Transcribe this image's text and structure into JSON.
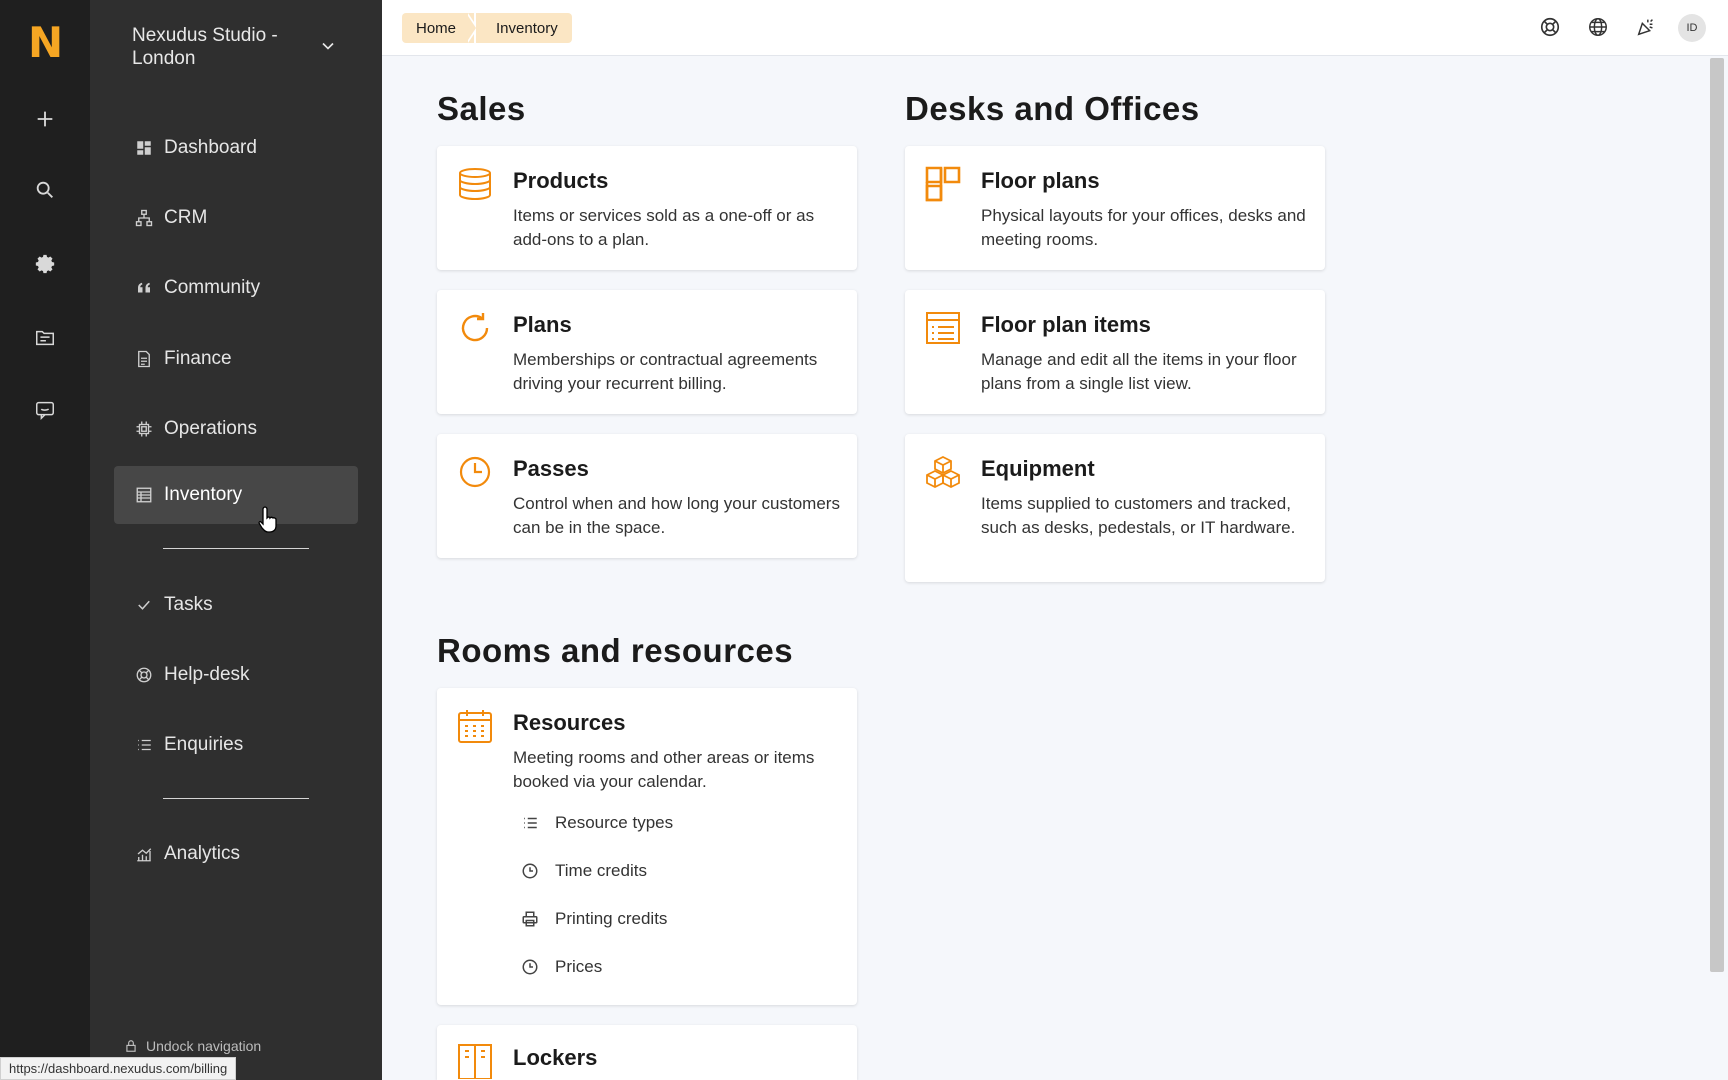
{
  "rail": {
    "logo": "N",
    "icons": [
      "plus-icon",
      "search-icon",
      "gear-icon",
      "folder-icon",
      "chat-icon"
    ]
  },
  "sidebar": {
    "org_name": "Nexudus Studio - London",
    "items": [
      {
        "label": "Dashboard",
        "icon": "dashboard-icon"
      },
      {
        "label": "CRM",
        "icon": "sitemap-icon"
      },
      {
        "label": "Community",
        "icon": "quote-icon"
      },
      {
        "label": "Finance",
        "icon": "document-icon"
      },
      {
        "label": "Operations",
        "icon": "chip-icon"
      },
      {
        "label": "Inventory",
        "icon": "table-icon",
        "active": true
      },
      {
        "label": "Tasks",
        "icon": "check-icon"
      },
      {
        "label": "Help-desk",
        "icon": "lifebuoy-icon"
      },
      {
        "label": "Enquiries",
        "icon": "list-icon"
      },
      {
        "label": "Analytics",
        "icon": "chart-icon"
      }
    ],
    "undock_label": "Undock navigation"
  },
  "breadcrumb": {
    "home": "Home",
    "current": "Inventory"
  },
  "topbar": {
    "avatar_initials": "ID",
    "icons": [
      "lifebuoy-icon",
      "globe-icon",
      "party-icon"
    ]
  },
  "sections": {
    "sales": {
      "title": "Sales",
      "cards": [
        {
          "title": "Products",
          "description": "Items or services sold as a one-off or as add-ons to a plan.",
          "icon": "database-icon"
        },
        {
          "title": "Plans",
          "description": "Memberships or contractual agreements driving your recurrent billing.",
          "icon": "refresh-icon"
        },
        {
          "title": "Passes",
          "description": "Control when and how long your customers can be in the space.",
          "icon": "clock-icon"
        }
      ]
    },
    "desks": {
      "title": "Desks and Offices",
      "cards": [
        {
          "title": "Floor plans",
          "description": "Physical layouts for your offices, desks and meeting rooms.",
          "icon": "floorplan-icon"
        },
        {
          "title": "Floor plan items",
          "description": "Manage and edit all the items in your floor plans from a single list view.",
          "icon": "list-box-icon"
        },
        {
          "title": "Equipment",
          "description": "Items supplied to customers and tracked, such as desks, pedestals, or IT hardware.",
          "icon": "boxes-icon"
        }
      ]
    },
    "rooms": {
      "title": "Rooms and resources",
      "resources": {
        "title": "Resources",
        "description": "Meeting rooms and other areas or items booked via your calendar.",
        "icon": "calendar-icon",
        "sub_items": [
          {
            "label": "Resource types",
            "icon": "list-icon"
          },
          {
            "label": "Time credits",
            "icon": "clock-icon"
          },
          {
            "label": "Printing credits",
            "icon": "printer-icon"
          },
          {
            "label": "Prices",
            "icon": "clock-icon"
          }
        ]
      },
      "lockers": {
        "title": "Lockers",
        "icon": "locker-icon"
      }
    }
  },
  "status_url": "https://dashboard.nexudus.com/billing",
  "colors": {
    "accent": "#f28a0c",
    "logo": "#f6a623",
    "sidebar_bg": "#2f2f2f",
    "rail_bg": "#1f1f1f",
    "breadcrumb_bg": "#fbe6c4"
  }
}
